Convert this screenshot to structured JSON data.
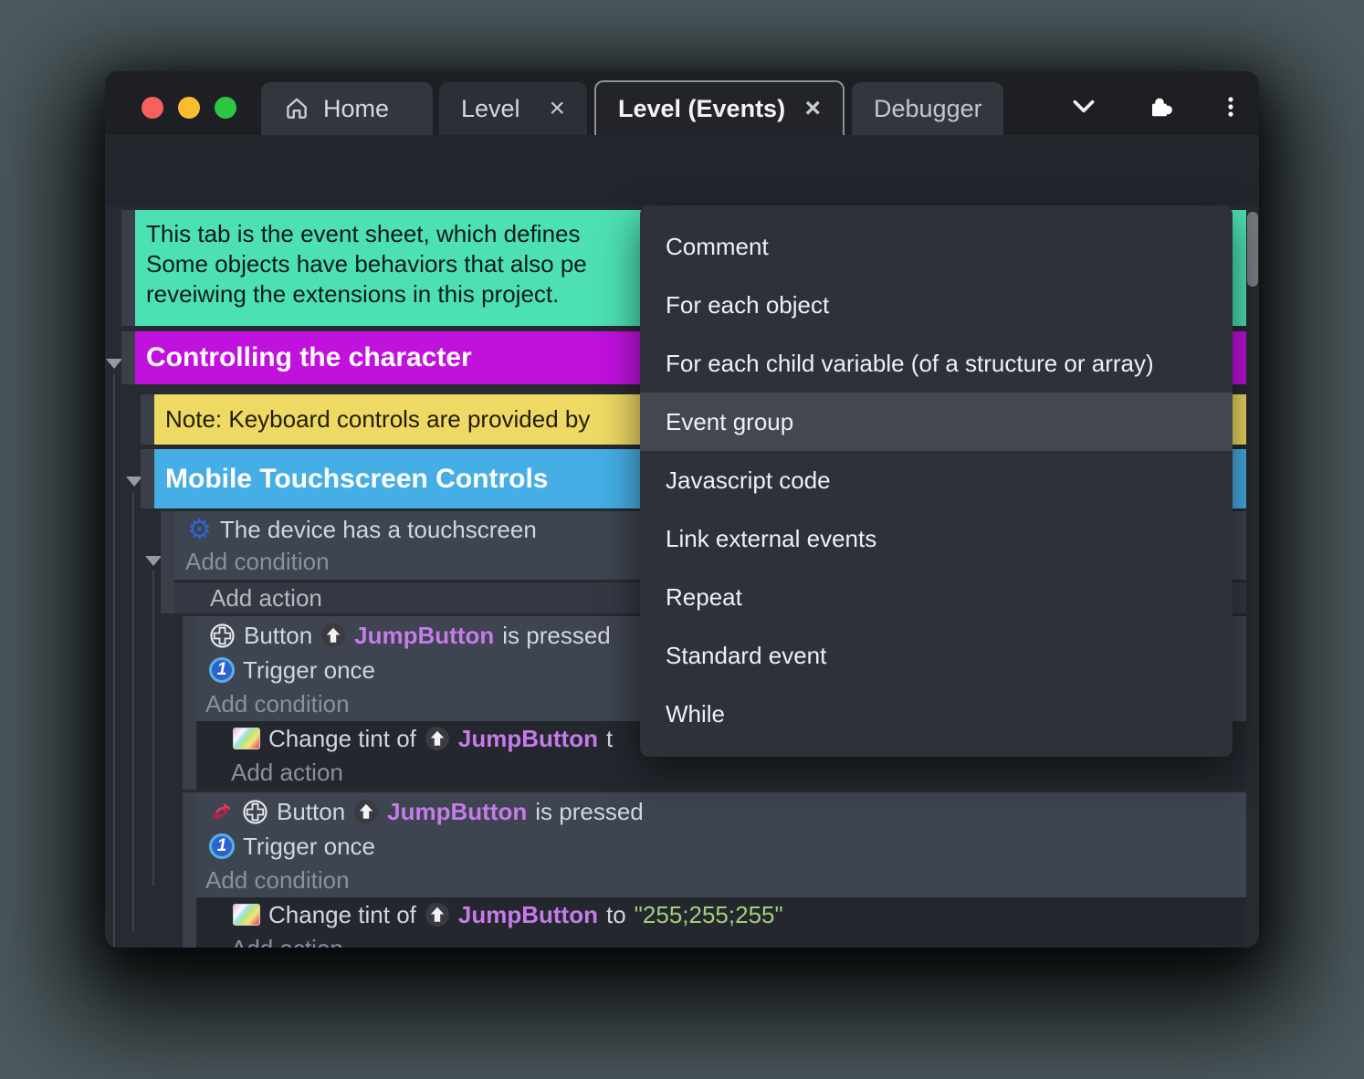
{
  "colors": {
    "accent_purple": "#5b2fd5",
    "comment_teal": "#4de0b5",
    "group_magenta": "#c011dd",
    "note_yellow": "#edd964",
    "group_blue": "#45aee5",
    "object_name_purple": "#c57bea",
    "string_green": "#a3cf7b"
  },
  "titlebar": {
    "tabs": [
      {
        "label": "Home"
      },
      {
        "label": "Level",
        "close": "×"
      },
      {
        "label": "Level (Events)",
        "close": "×"
      },
      {
        "label": "Debugger"
      }
    ]
  },
  "menu": {
    "items": [
      "Comment",
      "For each object",
      "For each child variable (of a structure or array)",
      "Event group",
      "Javascript code",
      "Link external events",
      "Repeat",
      "Standard event",
      "While"
    ],
    "highlighted": "Event group"
  },
  "sheet": {
    "comment": {
      "line1": "This tab is the event sheet, which defines",
      "line2": "Some objects have behaviors that also pe",
      "line3": "reveiwing the extensions in this project."
    },
    "group_controlling": "Controlling the character",
    "note": "Note: Keyboard controls are provided by",
    "group_mobile": "Mobile Touchscreen Controls",
    "labels": {
      "add_condition": "Add condition",
      "add_action": "Add action"
    },
    "touch_condition": "The device has a touchscreen",
    "button_event": {
      "name": "Button",
      "object": "JumpButton",
      "suffix": "is pressed"
    },
    "trigger_once": "Trigger once",
    "tint_action": {
      "prefix": "Change tint of",
      "object": "JumpButton",
      "partial_suffix": "t",
      "to": "to",
      "value": "\"255;255;255\""
    }
  }
}
